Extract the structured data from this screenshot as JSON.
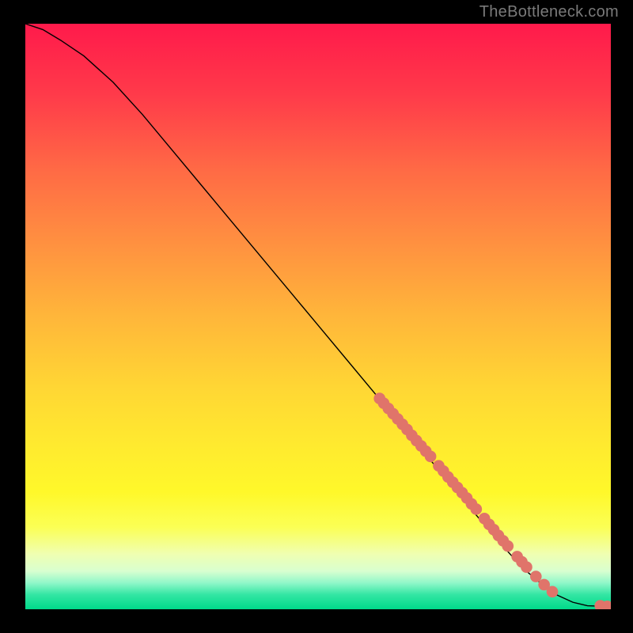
{
  "watermark": "TheBottleneck.com",
  "gradient": {
    "stops": [
      {
        "offset": 0.0,
        "color": "#ff1a4b"
      },
      {
        "offset": 0.12,
        "color": "#ff3a4a"
      },
      {
        "offset": 0.25,
        "color": "#ff6a45"
      },
      {
        "offset": 0.38,
        "color": "#ff9240"
      },
      {
        "offset": 0.5,
        "color": "#ffb63a"
      },
      {
        "offset": 0.62,
        "color": "#ffd634"
      },
      {
        "offset": 0.72,
        "color": "#ffea2f"
      },
      {
        "offset": 0.8,
        "color": "#fff82a"
      },
      {
        "offset": 0.86,
        "color": "#fbff55"
      },
      {
        "offset": 0.905,
        "color": "#f0ffb0"
      },
      {
        "offset": 0.935,
        "color": "#d8ffd0"
      },
      {
        "offset": 0.955,
        "color": "#90f7c9"
      },
      {
        "offset": 0.975,
        "color": "#33e6a3"
      },
      {
        "offset": 1.0,
        "color": "#00d98a"
      }
    ]
  },
  "chart_data": {
    "type": "line",
    "title": "",
    "xlabel": "",
    "ylabel": "",
    "xlim": [
      0,
      100
    ],
    "ylim": [
      0,
      100
    ],
    "series": [
      {
        "name": "curve",
        "x": [
          0,
          3,
          6,
          10,
          15,
          20,
          25,
          30,
          35,
          40,
          45,
          50,
          55,
          60,
          65,
          70,
          75,
          80,
          85,
          90,
          93.5,
          96,
          99,
          100
        ],
        "y": [
          100,
          99,
          97.2,
          94.5,
          90,
          84.5,
          78.5,
          72.5,
          66.5,
          60.5,
          54.5,
          48.5,
          42.5,
          36.5,
          30.5,
          24.5,
          18.5,
          12.5,
          7.0,
          2.8,
          1.2,
          0.6,
          0.5,
          0.5
        ]
      }
    ],
    "points": [
      {
        "x": 60.5,
        "y": 36.0,
        "r": 1.1
      },
      {
        "x": 61.2,
        "y": 35.2,
        "r": 1.1
      },
      {
        "x": 62.0,
        "y": 34.3,
        "r": 1.1
      },
      {
        "x": 62.8,
        "y": 33.4,
        "r": 1.1
      },
      {
        "x": 63.6,
        "y": 32.5,
        "r": 1.1
      },
      {
        "x": 64.4,
        "y": 31.6,
        "r": 1.1
      },
      {
        "x": 65.2,
        "y": 30.7,
        "r": 1.1
      },
      {
        "x": 66.0,
        "y": 29.7,
        "r": 1.1
      },
      {
        "x": 66.8,
        "y": 28.8,
        "r": 1.1
      },
      {
        "x": 67.6,
        "y": 27.9,
        "r": 1.1
      },
      {
        "x": 68.4,
        "y": 27.0,
        "r": 1.1
      },
      {
        "x": 69.2,
        "y": 26.1,
        "r": 1.1
      },
      {
        "x": 70.6,
        "y": 24.5,
        "r": 1.1
      },
      {
        "x": 71.4,
        "y": 23.6,
        "r": 1.1
      },
      {
        "x": 72.2,
        "y": 22.6,
        "r": 1.1
      },
      {
        "x": 73.0,
        "y": 21.7,
        "r": 1.1
      },
      {
        "x": 73.8,
        "y": 20.8,
        "r": 1.1
      },
      {
        "x": 74.6,
        "y": 19.9,
        "r": 1.1
      },
      {
        "x": 75.4,
        "y": 19.0,
        "r": 1.1
      },
      {
        "x": 76.2,
        "y": 18.0,
        "r": 1.1
      },
      {
        "x": 77.0,
        "y": 17.1,
        "r": 1.1
      },
      {
        "x": 78.4,
        "y": 15.5,
        "r": 1.1
      },
      {
        "x": 79.2,
        "y": 14.5,
        "r": 1.1
      },
      {
        "x": 80.0,
        "y": 13.6,
        "r": 1.1
      },
      {
        "x": 80.8,
        "y": 12.6,
        "r": 1.1
      },
      {
        "x": 81.6,
        "y": 11.7,
        "r": 1.1
      },
      {
        "x": 82.4,
        "y": 10.8,
        "r": 1.1
      },
      {
        "x": 84.0,
        "y": 9.0,
        "r": 1.1
      },
      {
        "x": 84.8,
        "y": 8.1,
        "r": 1.1
      },
      {
        "x": 85.6,
        "y": 7.2,
        "r": 1.1
      },
      {
        "x": 87.2,
        "y": 5.6,
        "r": 1.1
      },
      {
        "x": 88.6,
        "y": 4.2,
        "r": 1.1
      },
      {
        "x": 90.0,
        "y": 3.0,
        "r": 1.1
      },
      {
        "x": 98.2,
        "y": 0.6,
        "r": 1.1
      },
      {
        "x": 99.4,
        "y": 0.5,
        "r": 1.1
      }
    ]
  },
  "colors": {
    "point": "#e0746a",
    "line": "#000000"
  }
}
